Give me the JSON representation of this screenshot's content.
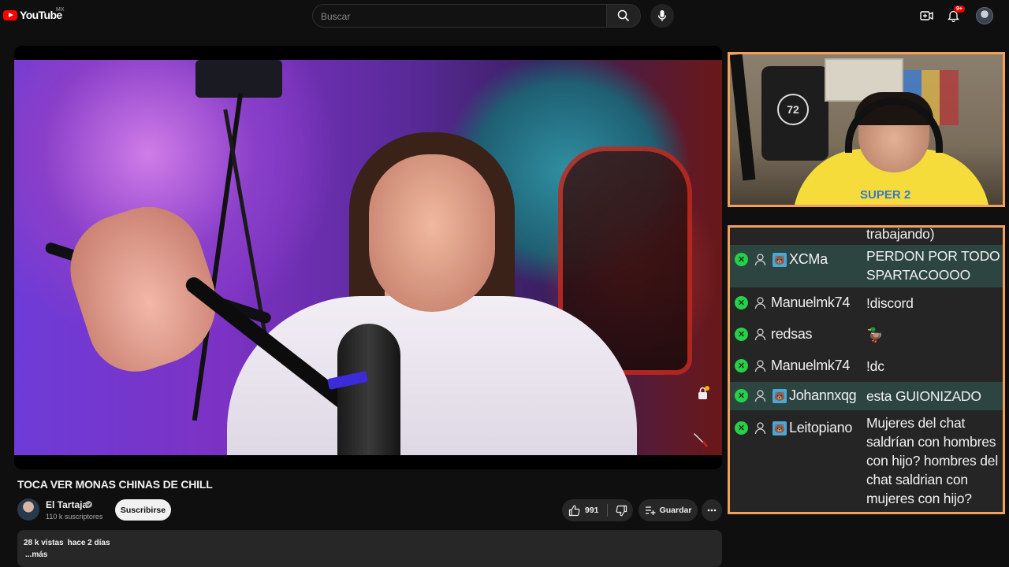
{
  "header": {
    "logo_text": "YouTube",
    "logo_region": "MX",
    "search_placeholder": "Buscar",
    "notifications_count": "9+"
  },
  "camera": {
    "jersey_number": "72",
    "shirt_text": "SUPER 2"
  },
  "chat": {
    "messages": [
      {
        "user": "",
        "text": "trabajando)",
        "badge_emote": false,
        "highlight": false
      },
      {
        "user": "XCMa",
        "text": "PERDON POR TODO SPARTACOOOO",
        "badge_emote": true,
        "highlight": true
      },
      {
        "user": "Manuelmk74",
        "text": "!discord",
        "badge_emote": false,
        "highlight": false
      },
      {
        "user": "redsas",
        "text": "🦆",
        "badge_emote": false,
        "highlight": false
      },
      {
        "user": "Manuelmk74",
        "text": "!dc",
        "badge_emote": false,
        "highlight": false
      },
      {
        "user": "Johannxqg",
        "text": "esta GUIONIZADO",
        "badge_emote": true,
        "highlight": true
      },
      {
        "user": "Leitopiano",
        "text": "Mujeres del chat saldrían con hombres con hijo? hombres del chat saldrian con mujeres con hijo?",
        "badge_emote": true,
        "highlight": false
      }
    ]
  },
  "video": {
    "title": "TOCA VER MONAS CHINAS DE CHILL",
    "channel_name": "El Tartaja",
    "subscribers": "110 k suscriptores",
    "subscribe_label": "Suscribirse",
    "likes": "991",
    "save_label": "Guardar",
    "views": "28 k vistas",
    "age": "hace 2 días",
    "more_label": "...más"
  },
  "colors": {
    "accent_red": "#ff0000",
    "overlay_border": "#f4a05a",
    "chat_highlight": "#2c4541",
    "mod_badge": "#27d04a"
  }
}
